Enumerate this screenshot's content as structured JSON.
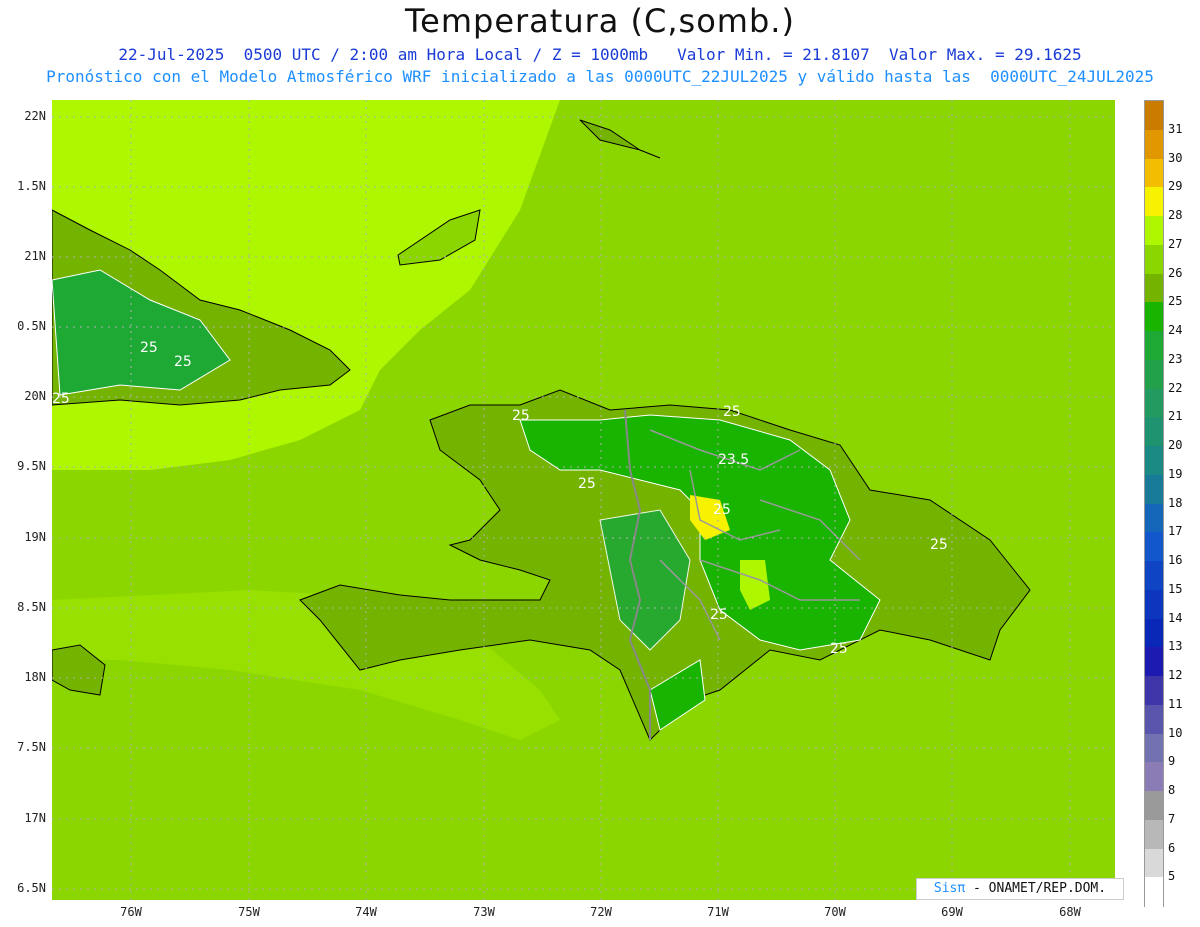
{
  "header": {
    "title": "Temperatura (C,somb.)",
    "line1": "22-Jul-2025  0500 UTC / 2:00 am Hora Local / Z = 1000mb   Valor Min. = 21.8107  Valor Max. = 29.1625",
    "line2": "Pronóstico con el Modelo Atmosférico WRF inicializado a las 0000UTC_22JUL2025 y válido hasta las  0000UTC_24JUL2025"
  },
  "axes": {
    "lat_labels": [
      "22N",
      "1.5N",
      "21N",
      "0.5N",
      "20N",
      "9.5N",
      "19N",
      "8.5N",
      "18N",
      "7.5N",
      "17N",
      "6.5N"
    ],
    "lon_labels": [
      "76W",
      "75W",
      "74W",
      "73W",
      "72W",
      "71W",
      "70W",
      "69W",
      "68W"
    ]
  },
  "contour_labels": [
    "25",
    "25",
    "25",
    "25",
    "25",
    "23.5",
    "25",
    "25",
    "25",
    "25",
    "25"
  ],
  "colorbar": {
    "labels": [
      "31",
      "30",
      "29",
      "28",
      "27",
      "26",
      "25",
      "24",
      "23",
      "22",
      "21",
      "20",
      "19",
      "18",
      "17",
      "16",
      "15",
      "14",
      "13",
      "12",
      "11",
      "10",
      "9",
      "8",
      "7",
      "6",
      "5"
    ],
    "colors": [
      "#c97c00",
      "#e19800",
      "#f3bd00",
      "#f7f200",
      "#aef700",
      "#8cd600",
      "#74b300",
      "#18b400",
      "#1ea834",
      "#23a04a",
      "#229a60",
      "#1f9270",
      "#1c8a84",
      "#177b97",
      "#1466b8",
      "#1257cc",
      "#0f44c4",
      "#0c36bd",
      "#0a28b8",
      "#1c1ab1",
      "#3d35a8",
      "#5955ac",
      "#7272b0",
      "#8b7cb6",
      "#9a9a9a",
      "#b8b8b8",
      "#d9d9d9",
      "#ffffff"
    ]
  },
  "credit": {
    "brand": "Sisπ",
    "text": " - ONAMET/REP.DOM."
  }
}
